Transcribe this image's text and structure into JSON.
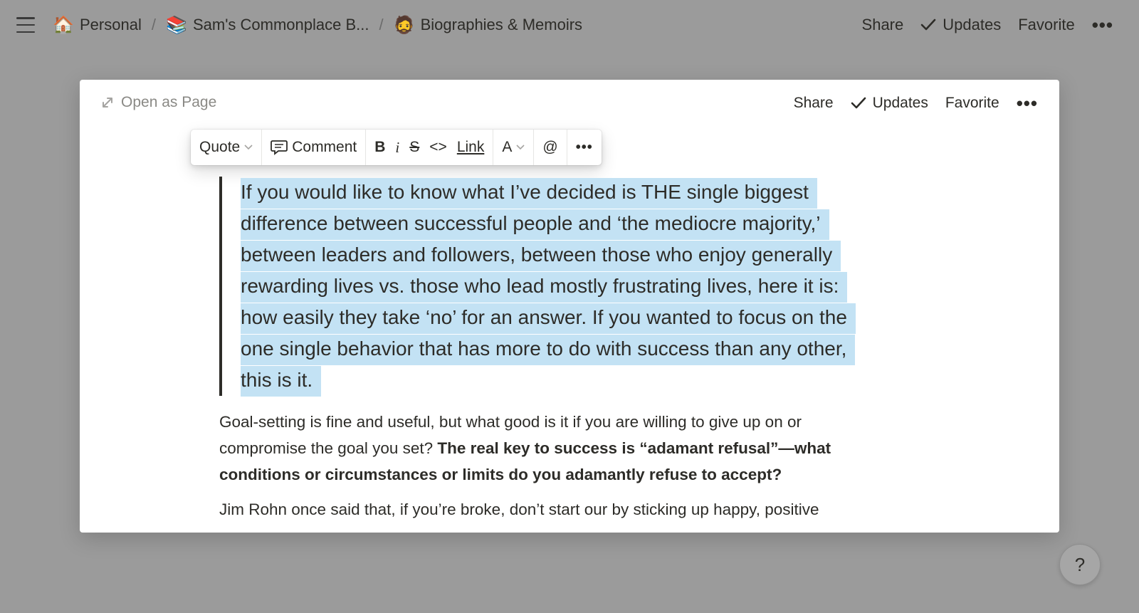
{
  "topbar": {
    "breadcrumbs": [
      {
        "emoji": "🏠",
        "label": "Personal"
      },
      {
        "emoji": "📚",
        "label": "Sam's Commonplace B..."
      },
      {
        "emoji": "🧔",
        "label": "Biographies & Memoirs"
      }
    ],
    "separator": "/",
    "share": "Share",
    "updates": "Updates",
    "favorite": "Favorite",
    "more": "•••"
  },
  "modal": {
    "open_as_page": "Open as Page",
    "share": "Share",
    "updates": "Updates",
    "favorite": "Favorite",
    "more": "•••"
  },
  "toolbar": {
    "block_type": "Quote",
    "comment": "Comment",
    "bold": "B",
    "italic": "i",
    "strike": "S",
    "code": "<>",
    "link": "Link",
    "color": "A",
    "mention": "@",
    "more": "•••"
  },
  "content": {
    "quote": "If you would like to know what I’ve decided is THE single biggest difference between successful people and ‘the mediocre majority,’ between leaders and followers, between those who enjoy generally rewarding lives vs. those who lead mostly frustrating lives, here it is: how easily they take ‘no’ for an answer. If you wanted to focus on the one single behavior that has more to do with success than any other, this is it.",
    "para1_plain": "Goal-setting is fine and useful, but what good is it if you are willing to give up on or compromise the goal you set? ",
    "para1_bold": "The real key to success is “adamant refusal”—what conditions or circumstances or limits do you adamantly refuse to accept?",
    "para2": "Jim Rohn once said that, if you’re broke, don’t start our by sticking up happy, positive"
  },
  "help": "?",
  "colors": {
    "backdrop": "#9b9b9b",
    "selection": "#c3e2f4",
    "text": "#2d2c28",
    "muted": "#8a8985"
  }
}
